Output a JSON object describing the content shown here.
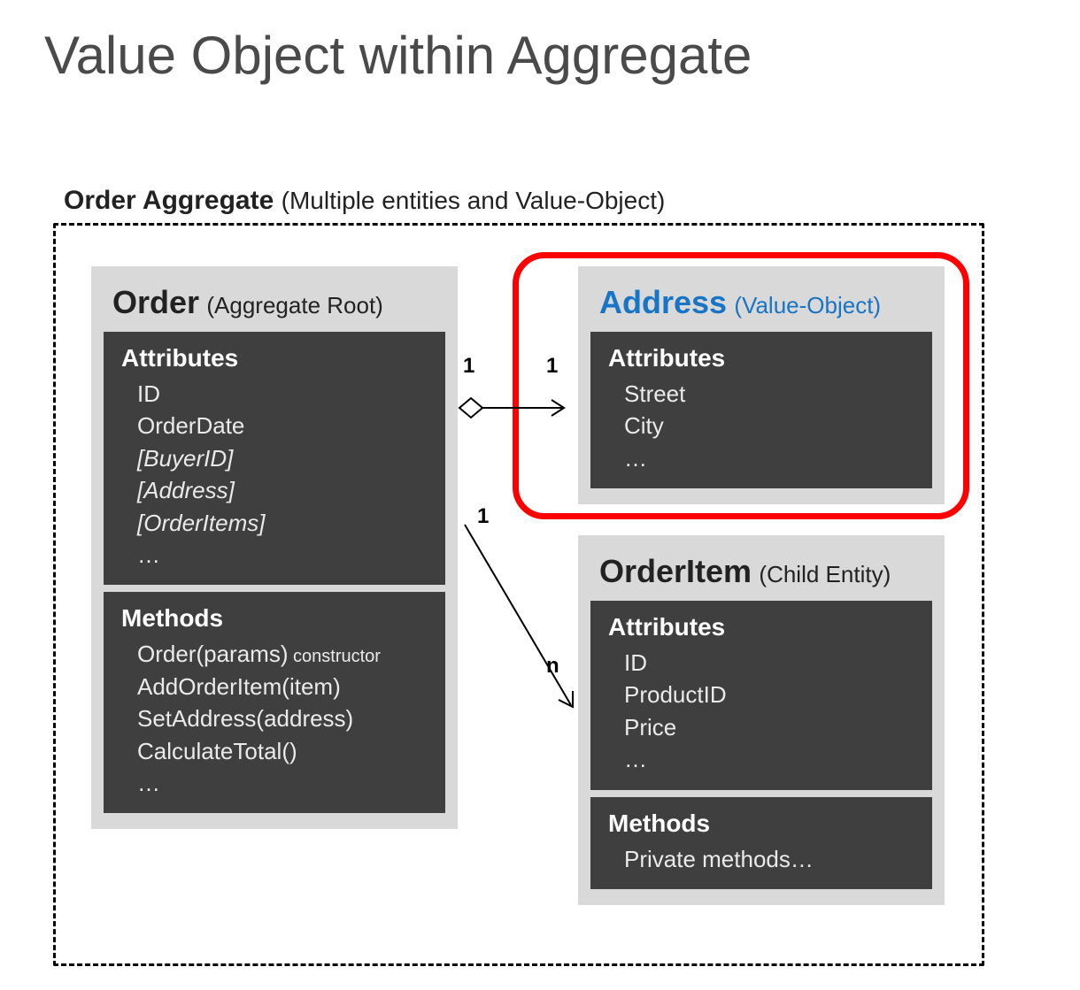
{
  "title": "Value Object within Aggregate",
  "aggregate": {
    "label_bold": "Order Aggregate",
    "label_note": "(Multiple entities and Value-Object)"
  },
  "order": {
    "title_bold": "Order",
    "title_note": "(Aggregate Root)",
    "attributes_title": "Attributes",
    "attrs": {
      "a0": "ID",
      "a1": "OrderDate",
      "a2": "[BuyerID]",
      "a3": "[Address]",
      "a4": "[OrderItems]",
      "a5": "…"
    },
    "methods_title": "Methods",
    "methods": {
      "m0_main": "Order(params)",
      "m0_suffix": " constructor",
      "m1": "AddOrderItem(item)",
      "m2": "SetAddress(address)",
      "m3": "CalculateTotal()",
      "m4": "…"
    }
  },
  "address": {
    "title_bold": "Address",
    "title_note": "(Value-Object)",
    "attributes_title": "Attributes",
    "attrs": {
      "a0": "Street",
      "a1": "City",
      "a2": "…"
    }
  },
  "orderitem": {
    "title_bold": "OrderItem",
    "title_note": "(Child Entity)",
    "attributes_title": "Attributes",
    "attrs": {
      "a0": "ID",
      "a1": "ProductID",
      "a2": "Price",
      "a3": "…"
    },
    "methods_title": "Methods",
    "methods": {
      "m0": "Private methods…"
    }
  },
  "multiplicity": {
    "order_to_address_left": "1",
    "order_to_address_right": "1",
    "order_to_item_left": "1",
    "order_to_item_right": "n"
  }
}
